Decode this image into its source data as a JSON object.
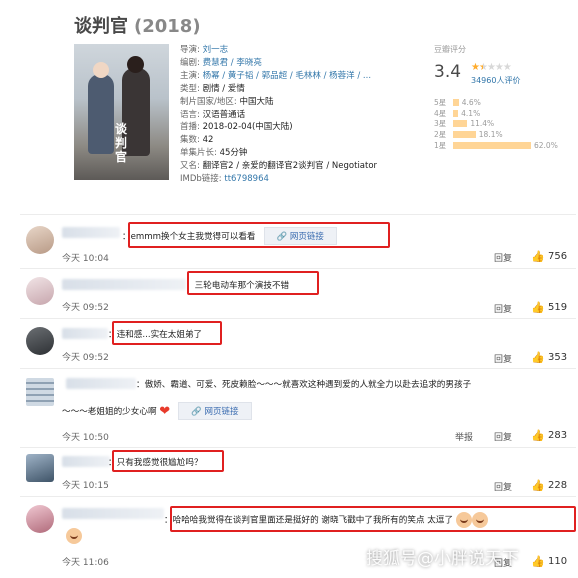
{
  "movie": {
    "title": "谈判官",
    "year": "(2018)",
    "poster_text": "谈判官",
    "info_rows": [
      {
        "label": "导演:",
        "value": "刘一志",
        "link": true
      },
      {
        "label": "编剧:",
        "value": "费慧君 / 李晓亮",
        "link": true
      },
      {
        "label": "主演:",
        "value": "杨幂 / 黄子韬 / 郭品超 / 毛林林 / 杨蓉洋 / ...",
        "link": true
      },
      {
        "label": "类型:",
        "value": "剧情 / 爱情",
        "link": false
      },
      {
        "label": "制片国家/地区:",
        "value": "中国大陆",
        "link": false
      },
      {
        "label": "语言:",
        "value": "汉语普通话",
        "link": false
      },
      {
        "label": "首播:",
        "value": "2018-02-04(中国大陆)",
        "link": false
      },
      {
        "label": "集数:",
        "value": "42",
        "link": false
      },
      {
        "label": "单集片长:",
        "value": "45分钟",
        "link": false
      },
      {
        "label": "又名:",
        "value": "翻译官2 / 亲爱的翻译官2谈判官 / Negotiator",
        "link": false
      },
      {
        "label": "IMDb链接:",
        "value": "tt6798964",
        "link": true
      }
    ],
    "rating": {
      "label": "豆瓣评分",
      "score": "3.4",
      "stars_filled": 1.5,
      "votes": "34960人评价",
      "distribution": [
        {
          "stars": "5星",
          "pct": "4.6%",
          "value": 4.6
        },
        {
          "stars": "4星",
          "pct": "4.1%",
          "value": 4.1
        },
        {
          "stars": "3星",
          "pct": "11.4%",
          "value": 11.4
        },
        {
          "stars": "2星",
          "pct": "18.1%",
          "value": 18.1
        },
        {
          "stars": "1星",
          "pct": "62.0%",
          "value": 62.0
        }
      ]
    }
  },
  "comments": [
    {
      "text": "：emmm换个女主我觉得可以看看",
      "link_label": "网页链接",
      "time": "今天 10:04",
      "reply": "回复",
      "likes": "756"
    },
    {
      "text": "：三轮电动车那个演技不错",
      "time": "今天 09:52",
      "reply": "回复",
      "likes": "519"
    },
    {
      "text": "：违和感...实在太姐弟了",
      "time": "今天 09:52",
      "reply": "回复",
      "likes": "353"
    },
    {
      "text": "：傲娇、霸道、可爱、死皮赖脸～～～就喜欢这种遇到爱的人就全力以赴去追求的男孩子",
      "text2": "～～～老姐姐的少女心啊",
      "link_label": "网页链接",
      "time": "今天 10:50",
      "report": "举报",
      "reply": "回复",
      "likes": "283"
    },
    {
      "text": "：只有我感觉很尴尬吗？",
      "time": "今天 10:15",
      "reply": "回复",
      "likes": "228"
    },
    {
      "text": "：哈哈哈我觉得在谈判官里面还是挺好的 谢晓飞戳中了我所有的笑点 太逗了",
      "time": "今天 11:06",
      "reply": "回复",
      "likes": "110"
    }
  ],
  "watermark": "搜狐号@小胖说天下",
  "colors": {
    "highlight": "#e02020",
    "link": "#3377aa",
    "star": "#ffac2d",
    "bar": "#ffd596"
  }
}
